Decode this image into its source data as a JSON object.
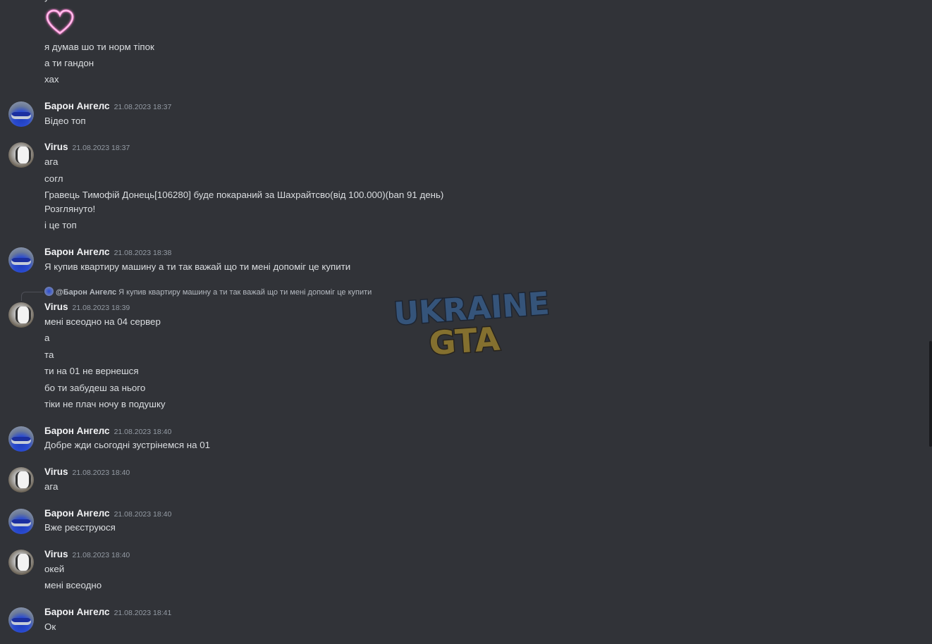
{
  "top_fragment": "у",
  "heart_icon": "heart-icon",
  "top_lines": [
    "я думав шо ти норм  тіпок",
    "а ти гандон",
    "хах"
  ],
  "groups": [
    {
      "author": "Барон Ангелс",
      "time": "21.08.2023 18:37",
      "lines": [
        "Відео топ"
      ]
    },
    {
      "author": "Virus",
      "time": "21.08.2023 18:37",
      "lines": [
        "ага",
        "согл",
        "Гравець Тимофій Донець[106280] буде покараний за Шахрайтсво(від 100.000)(ban 91 день)",
        "Розглянуто!",
        "і це топ"
      ]
    },
    {
      "author": "Барон Ангелс",
      "time": "21.08.2023 18:38",
      "lines": [
        "Я купив квартиру машину а ти так важай що ти мені допоміг це купити"
      ]
    },
    {
      "author": "Virus",
      "time": "21.08.2023 18:39",
      "reply": {
        "mention": "@Барон Ангелс",
        "text": "Я купив квартиру машину а ти так важай що ти мені допоміг це купити"
      },
      "lines": [
        "мені всеодно на 04 сервер",
        "а",
        "та",
        "ти на 01 не вернешся",
        "бо ти  забудеш за нього",
        "тіки не плач ночу в подушку"
      ]
    },
    {
      "author": "Барон Ангелс",
      "time": "21.08.2023 18:40",
      "lines": [
        "Добре жди сьогодні зустрінемся на 01"
      ]
    },
    {
      "author": "Virus",
      "time": "21.08.2023 18:40",
      "lines": [
        "ага"
      ]
    },
    {
      "author": "Барон Ангелс",
      "time": "21.08.2023 18:40",
      "lines": [
        "Вже реєструюся"
      ]
    },
    {
      "author": "Virus",
      "time": "21.08.2023 18:40",
      "lines": [
        "окей",
        "мені всеодно"
      ]
    },
    {
      "author": "Барон Ангелс",
      "time": "21.08.2023 18:41",
      "lines": [
        "Ок"
      ]
    }
  ],
  "watermark": {
    "line1": "UKRAINE",
    "line2": "GTA"
  },
  "colors": {
    "background": "#313338",
    "text": "#dbdee1",
    "author": "#f2f3f5",
    "timestamp": "#949ba4"
  }
}
